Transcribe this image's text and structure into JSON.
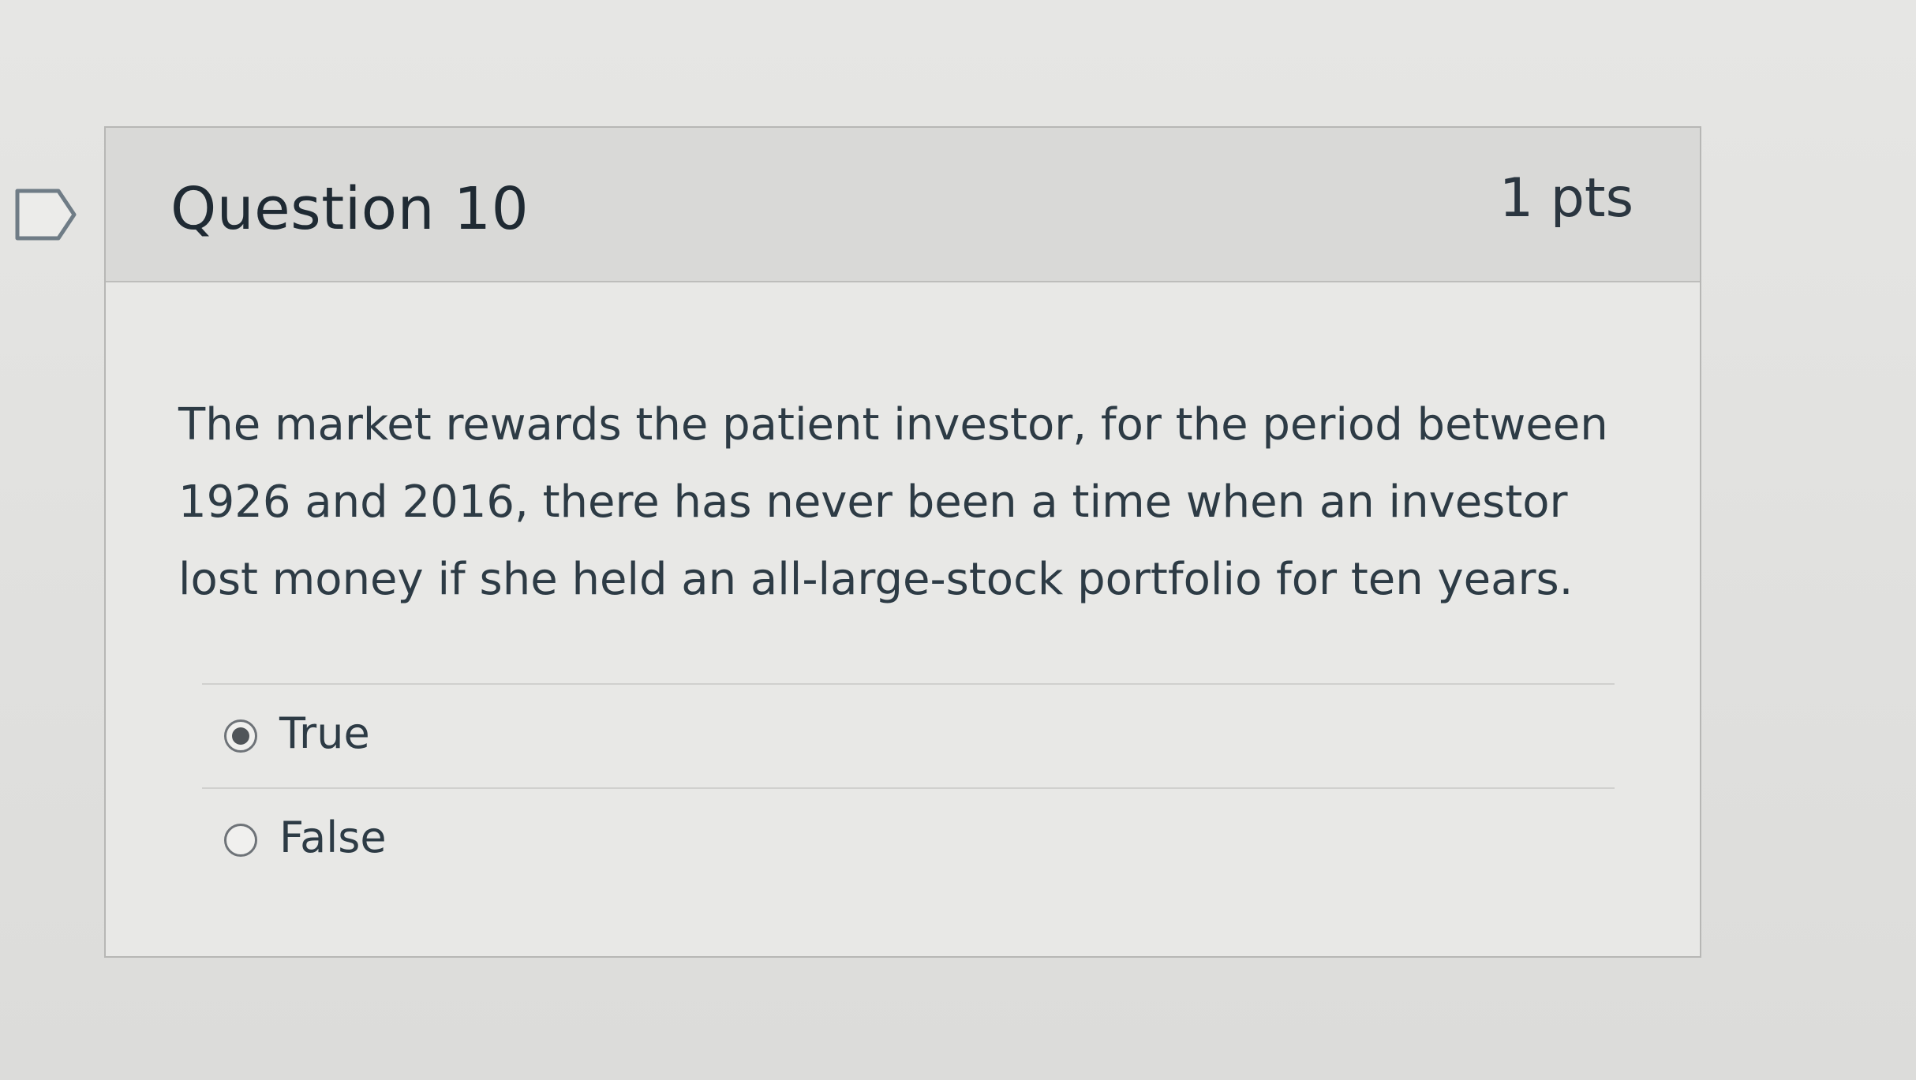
{
  "question": {
    "title": "Question 10",
    "points": "1 pts",
    "text": "The market rewards the patient investor, for the period between 1926 and 2016, there has never been a time when an investor lost money if she held an all-large-stock portfolio for ten years.",
    "flag_icon": "flag-outline-icon",
    "answers": [
      {
        "label": "True",
        "selected": true
      },
      {
        "label": "False",
        "selected": false
      }
    ]
  },
  "colors": {
    "background": "#e2e2e0",
    "header": "#d9d9d7",
    "text": "#2d3b45"
  }
}
